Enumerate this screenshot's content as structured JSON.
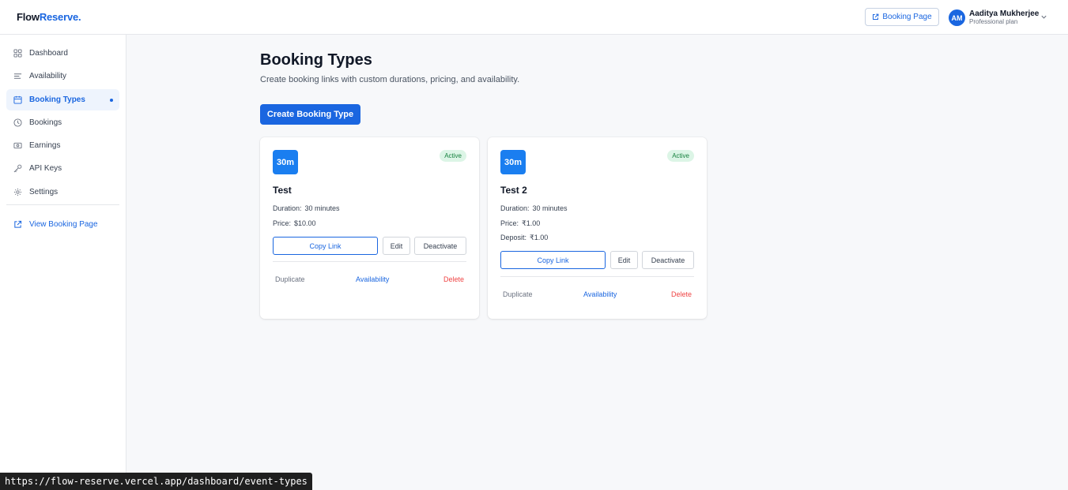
{
  "app": {
    "brand_part1": "Flow",
    "brand_part2": "Reserve",
    "brand_dot": ".",
    "booking_page_button": "Booking Page",
    "user": {
      "initials": "AM",
      "name": "Aaditya Mukherjee",
      "plan": "Professional plan"
    }
  },
  "sidebar": {
    "items": [
      {
        "label": "Dashboard",
        "icon": "grid-icon"
      },
      {
        "label": "Availability",
        "icon": "lines-icon"
      },
      {
        "label": "Booking Types",
        "icon": "calendar-icon",
        "active": true
      },
      {
        "label": "Bookings",
        "icon": "clock-icon"
      },
      {
        "label": "Earnings",
        "icon": "wallet-icon"
      },
      {
        "label": "API Keys",
        "icon": "key-icon"
      },
      {
        "label": "Settings",
        "icon": "gear-icon"
      }
    ],
    "view_booking_page": "View Booking Page"
  },
  "main": {
    "title": "Booking Types",
    "subtitle": "Create booking links with custom durations, pricing, and availability.",
    "create_button": "Create Booking Type",
    "cards": [
      {
        "badge": "30m",
        "status": "Active",
        "title": "Test",
        "duration_label": "Duration:",
        "duration_value": "30 minutes",
        "price_label": "Price:",
        "price_value": "$10.00",
        "copy_link": "Copy Link",
        "edit": "Edit",
        "deactivate": "Deactivate",
        "duplicate": "Duplicate",
        "availability": "Availability",
        "delete": "Delete"
      },
      {
        "badge": "30m",
        "status": "Active",
        "title": "Test 2",
        "duration_label": "Duration:",
        "duration_value": "30 minutes",
        "price_label": "Price:",
        "price_value": "₹1.00",
        "deposit_label": "Deposit:",
        "deposit_value": "₹1.00",
        "copy_link": "Copy Link",
        "edit": "Edit",
        "deactivate": "Deactivate",
        "duplicate": "Duplicate",
        "availability": "Availability",
        "delete": "Delete"
      }
    ]
  },
  "statusbar": {
    "url": "https://flow-reserve.vercel.app/dashboard/event-types"
  },
  "colors": {
    "accent": "#1a66e0",
    "badge": "#1a7ef0",
    "active_bg": "#dcf5e6",
    "active_text": "#15803d",
    "danger": "#ef4444"
  }
}
